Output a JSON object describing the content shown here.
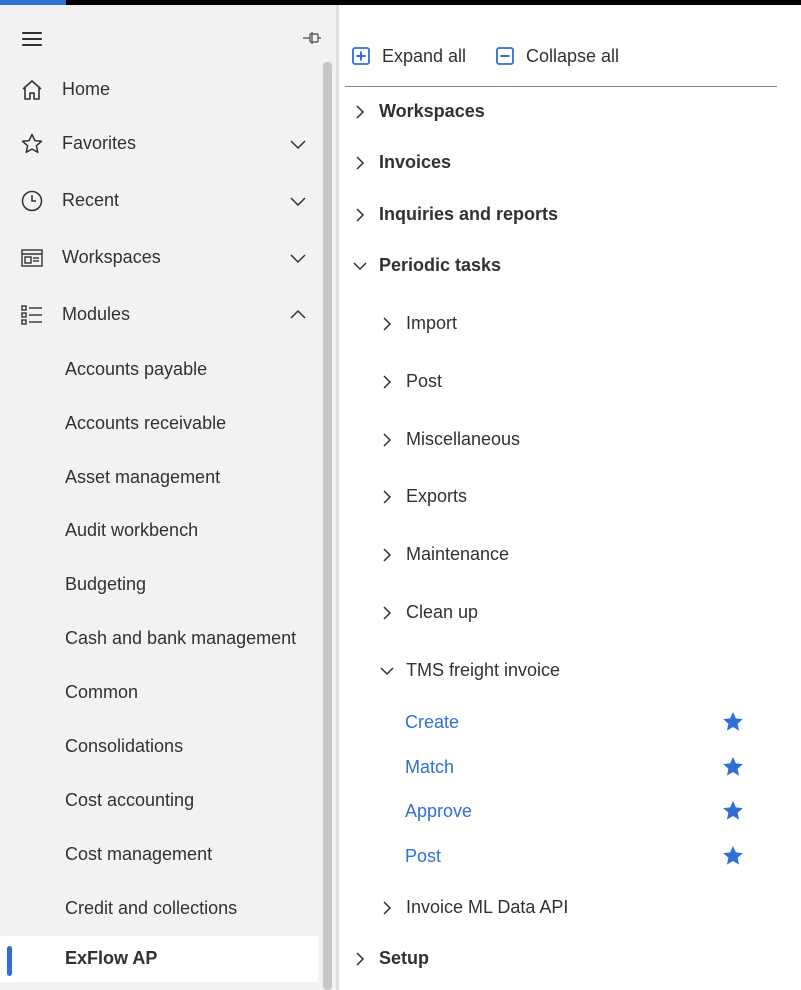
{
  "nav": {
    "menu_icon": "hamburger-icon",
    "pin_icon": "pin-icon",
    "items": [
      {
        "label": "Home",
        "icon": "home-icon"
      },
      {
        "label": "Favorites",
        "icon": "star-outline-icon",
        "expanded": false
      },
      {
        "label": "Recent",
        "icon": "clock-icon",
        "expanded": false
      },
      {
        "label": "Workspaces",
        "icon": "workspace-icon",
        "expanded": false
      },
      {
        "label": "Modules",
        "icon": "modules-list-icon",
        "expanded": true
      }
    ],
    "modules": [
      "Accounts payable",
      "Accounts receivable",
      "Asset management",
      "Audit workbench",
      "Budgeting",
      "Cash and bank management",
      "Common",
      "Consolidations",
      "Cost accounting",
      "Cost management",
      "Credit and collections",
      "ExFlow AP"
    ],
    "selected_module": "ExFlow AP"
  },
  "toolbar": {
    "expand_all": "Expand all",
    "collapse_all": "Collapse all"
  },
  "tree": {
    "groups": [
      {
        "label": "Workspaces",
        "expanded": false
      },
      {
        "label": "Invoices",
        "expanded": false
      },
      {
        "label": "Inquiries and reports",
        "expanded": false
      },
      {
        "label": "Periodic tasks",
        "expanded": true
      },
      {
        "label": "Setup",
        "expanded": false
      }
    ],
    "periodic_tasks": [
      {
        "label": "Import",
        "expanded": false
      },
      {
        "label": "Post",
        "expanded": false
      },
      {
        "label": "Miscellaneous",
        "expanded": false
      },
      {
        "label": "Exports",
        "expanded": false
      },
      {
        "label": "Maintenance",
        "expanded": false
      },
      {
        "label": "Clean up",
        "expanded": false
      },
      {
        "label": "TMS freight invoice",
        "expanded": true
      },
      {
        "label": "Invoice ML Data API",
        "expanded": false
      }
    ],
    "tms_links": [
      {
        "label": "Create",
        "favorite": true
      },
      {
        "label": "Match",
        "favorite": true
      },
      {
        "label": "Approve",
        "favorite": true
      },
      {
        "label": "Post",
        "favorite": true
      }
    ]
  },
  "colors": {
    "accent": "#2f6fd6",
    "nav_bg": "#f3f2f1",
    "text": "#323130"
  }
}
